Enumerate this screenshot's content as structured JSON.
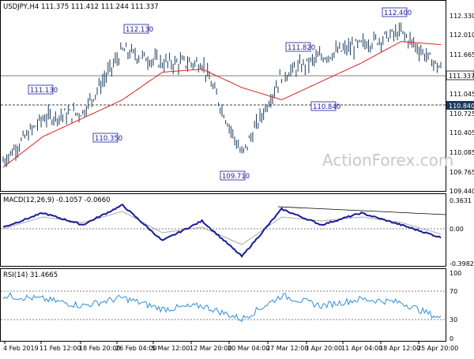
{
  "header": {
    "symbol_info": "USDJPY,H4  111.375 111.412 111.244 111.337",
    "macd_label": "MACD(12,26,9) -0.1057 -0.0660",
    "rsi_label": "RSI(14) 31.4665"
  },
  "watermark": "ActionForex.com",
  "price_axis": {
    "ticks": [
      "112.330",
      "112.010",
      "111.665",
      "111.045",
      "110.725",
      "110.405",
      "110.085",
      "109.765",
      "109.440"
    ],
    "current_price_tag": "111.337",
    "support_tag": "110.840",
    "support_value": 110.84,
    "current_value": 111.337
  },
  "macd_axis": {
    "ticks": [
      "0.3631",
      "0.00",
      "-0.3982"
    ]
  },
  "rsi_axis": {
    "ticks": [
      "100",
      "70",
      "30",
      "0"
    ]
  },
  "time_axis": {
    "labels": [
      "4 Feb 2019",
      "11 Feb 12:00",
      "18 Feb 20:00",
      "26 Feb 04:00",
      "5 Mar 12:00",
      "12 Mar 20:00",
      "20 Mar 04:00",
      "27 Mar 12:00",
      "3 Apr 20:00",
      "11 Apr 04:00",
      "18 Apr 12:00",
      "25 Apr 20:00"
    ]
  },
  "annotations": [
    {
      "label": "111.130",
      "value": 111.13
    },
    {
      "label": "110.350",
      "value": 110.35
    },
    {
      "label": "112.130",
      "value": 112.13
    },
    {
      "label": "109.710",
      "value": 109.71
    },
    {
      "label": "111.820",
      "value": 111.82
    },
    {
      "label": "110.840",
      "value": 110.84
    },
    {
      "label": "112.400",
      "value": 112.4
    }
  ],
  "colors": {
    "candles": "#1a3a5c",
    "ema": "#e02020",
    "macd": "#1a1a99",
    "signal": "#aaaaaa",
    "rsi": "#2f8fd8",
    "annotation": "#1a1a99",
    "watermark": "#c8c8c8"
  },
  "chart_data": {
    "type": "line",
    "price": {
      "x": [
        "4 Feb 2019",
        "11 Feb 12:00",
        "18 Feb 20:00",
        "26 Feb 04:00",
        "5 Mar 12:00",
        "12 Mar 20:00",
        "20 Mar 04:00",
        "27 Mar 12:00",
        "3 Apr 20:00",
        "11 Apr 04:00",
        "18 Apr 12:00",
        "25 Apr 20:00"
      ],
      "close": [
        109.9,
        110.6,
        110.7,
        111.7,
        111.5,
        111.5,
        110.0,
        111.3,
        111.6,
        111.8,
        112.0,
        111.4
      ],
      "ema": [
        109.8,
        110.3,
        110.6,
        110.9,
        111.35,
        111.4,
        111.1,
        110.9,
        111.2,
        111.5,
        111.85,
        111.8
      ],
      "ylim": [
        109.44,
        112.45
      ]
    },
    "macd": {
      "x": [
        "4 Feb 2019",
        "11 Feb 12:00",
        "18 Feb 20:00",
        "26 Feb 04:00",
        "5 Mar 12:00",
        "12 Mar 20:00",
        "20 Mar 04:00",
        "27 Mar 12:00",
        "3 Apr 20:00",
        "11 Apr 04:00",
        "18 Apr 12:00",
        "25 Apr 20:00"
      ],
      "values": [
        0.02,
        0.2,
        0.05,
        0.3,
        -0.15,
        0.1,
        -0.35,
        0.25,
        0.05,
        0.2,
        0.05,
        -0.11
      ],
      "signal": [
        0.0,
        0.15,
        0.08,
        0.22,
        -0.05,
        0.02,
        -0.2,
        0.15,
        0.1,
        0.15,
        0.08,
        -0.066
      ],
      "ylim": [
        -0.45,
        0.4
      ]
    },
    "rsi": {
      "x": [
        "4 Feb 2019",
        "11 Feb 12:00",
        "18 Feb 20:00",
        "26 Feb 04:00",
        "5 Mar 12:00",
        "12 Mar 20:00",
        "20 Mar 04:00",
        "27 Mar 12:00",
        "3 Apr 20:00",
        "11 Apr 04:00",
        "18 Apr 12:00",
        "25 Apr 20:00"
      ],
      "values": [
        65,
        60,
        50,
        62,
        45,
        50,
        30,
        65,
        50,
        60,
        55,
        31
      ],
      "ylim": [
        0,
        100
      ]
    }
  }
}
